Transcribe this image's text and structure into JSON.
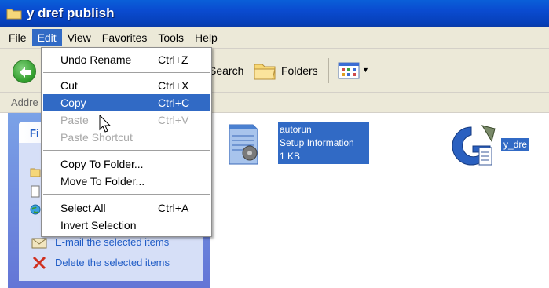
{
  "window": {
    "title": "y dref publish"
  },
  "menubar": {
    "items": [
      "File",
      "Edit",
      "View",
      "Favorites",
      "Tools",
      "Help"
    ],
    "active": "Edit"
  },
  "toolbar": {
    "search_label": "Search",
    "folders_label": "Folders"
  },
  "addressbar": {
    "label": "Addre"
  },
  "edit_menu": {
    "items": [
      {
        "label": "Undo Rename",
        "shortcut": "Ctrl+Z",
        "state": "normal"
      },
      {
        "label": "Cut",
        "shortcut": "Ctrl+X",
        "state": "normal"
      },
      {
        "label": "Copy",
        "shortcut": "Ctrl+C",
        "state": "selected"
      },
      {
        "label": "Paste",
        "shortcut": "Ctrl+V",
        "state": "disabled"
      },
      {
        "label": "Paste Shortcut",
        "shortcut": "",
        "state": "disabled"
      },
      {
        "label": "Copy To Folder...",
        "shortcut": "",
        "state": "normal"
      },
      {
        "label": "Move To Folder...",
        "shortcut": "",
        "state": "normal"
      },
      {
        "label": "Select All",
        "shortcut": "Ctrl+A",
        "state": "normal"
      },
      {
        "label": "Invert Selection",
        "shortcut": "",
        "state": "normal"
      }
    ]
  },
  "taskpane": {
    "heading": "Fi",
    "links": [
      "E-mail the selected items",
      "Delete the selected items"
    ]
  },
  "files": [
    {
      "name": "autorun",
      "type": "Setup Information",
      "size": "1 KB"
    },
    {
      "name": "y_dre"
    }
  ],
  "colors": {
    "selection": "#316ac5",
    "titlebar": "#0a4bd0",
    "menu_bg": "#ece9d8"
  }
}
